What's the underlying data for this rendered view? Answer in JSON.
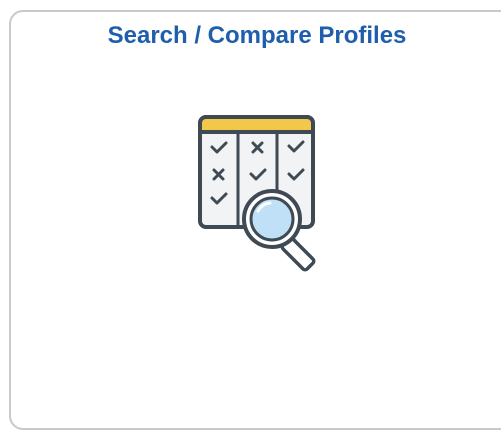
{
  "tile": {
    "title": "Search / Compare Profiles",
    "icon": "search-compare-profiles-icon"
  },
  "colors": {
    "title": "#1f5eac",
    "tile_border": "#c9c9c9",
    "grid_header": "#f2c84b",
    "grid_body": "#f1f3f5",
    "grid_stroke": "#3f4a55",
    "magnifier_lens": "#bfe0f6"
  }
}
